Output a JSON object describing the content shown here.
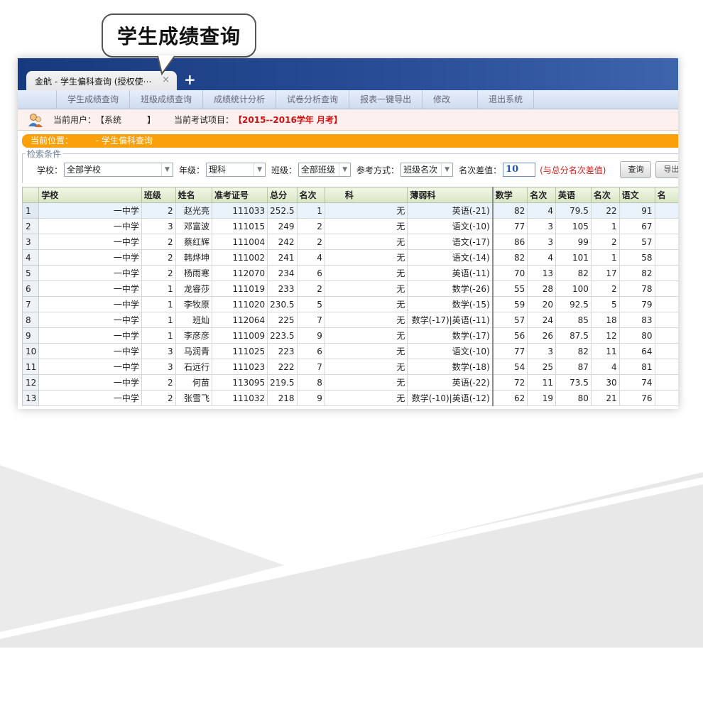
{
  "callout": {
    "text": "学生成绩查询"
  },
  "tab": {
    "title": "金航 - 学生偏科查询 (授权使⋯",
    "close": "×",
    "new": "+"
  },
  "menu": [
    "学生成绩查询",
    "班级成绩查询",
    "成绩统计分析",
    "试卷分析查询",
    "报表一键导出",
    "修改",
    "退出系统"
  ],
  "user": {
    "label": "当前用户：",
    "value": "【系统　　　】",
    "exam_label": "当前考试项目：",
    "exam_value": "【2015--2016学年 月考】"
  },
  "location": {
    "label": "当前位置：",
    "value": "- 学生偏科查询"
  },
  "search": {
    "legend": "检索条件",
    "school_label": "学校：",
    "school_value": "全部学校",
    "grade_label": "年级：",
    "grade_value": "理科",
    "class_label": "班级：",
    "class_value": "全部班级",
    "mode_label": "参考方式：",
    "mode_value": "班级名次",
    "diff_label": "名次差值：",
    "diff_value": "10",
    "diff_note": "(与总分名次差值)",
    "query_button": "查询",
    "export_button": "导出"
  },
  "table": {
    "headers": [
      "",
      "学校",
      "班级",
      "姓名",
      "准考证号",
      "总分",
      "名次",
      "科",
      "薄弱科",
      "数学",
      "名次",
      "英语",
      "名次",
      "语文",
      "名"
    ],
    "rows": [
      [
        "1",
        "一中学",
        "2",
        "赵光亮",
        "111033",
        "252.5",
        "1",
        "无",
        "英语(-21)",
        "82",
        "4",
        "79.5",
        "22",
        "91"
      ],
      [
        "2",
        "一中学",
        "3",
        "邓富波",
        "111015",
        "249",
        "2",
        "无",
        "语文(-10)",
        "77",
        "3",
        "105",
        "1",
        "67"
      ],
      [
        "3",
        "一中学",
        "2",
        "蔡红辉",
        "111004",
        "242",
        "2",
        "无",
        "语文(-17)",
        "86",
        "3",
        "99",
        "2",
        "57"
      ],
      [
        "4",
        "一中学",
        "2",
        "韩烨坤",
        "111002",
        "241",
        "4",
        "无",
        "语文(-14)",
        "82",
        "4",
        "101",
        "1",
        "58"
      ],
      [
        "5",
        "一中学",
        "2",
        "杨雨寒",
        "112070",
        "234",
        "6",
        "无",
        "英语(-11)",
        "70",
        "13",
        "82",
        "17",
        "82"
      ],
      [
        "6",
        "一中学",
        "1",
        "龙睿莎",
        "111019",
        "233",
        "2",
        "无",
        "数学(-26)",
        "55",
        "28",
        "100",
        "2",
        "78"
      ],
      [
        "7",
        "一中学",
        "1",
        "李牧原",
        "111020",
        "230.5",
        "5",
        "无",
        "数学(-15)",
        "59",
        "20",
        "92.5",
        "5",
        "79"
      ],
      [
        "8",
        "一中学",
        "1",
        "班灿",
        "112064",
        "225",
        "7",
        "无",
        "数学(-17)|英语(-11)",
        "57",
        "24",
        "85",
        "18",
        "83"
      ],
      [
        "9",
        "一中学",
        "1",
        "李彦彦",
        "111009",
        "223.5",
        "9",
        "无",
        "数学(-17)",
        "56",
        "26",
        "87.5",
        "12",
        "80"
      ],
      [
        "10",
        "一中学",
        "3",
        "马润青",
        "111025",
        "223",
        "6",
        "无",
        "语文(-10)",
        "77",
        "3",
        "82",
        "11",
        "64"
      ],
      [
        "11",
        "一中学",
        "3",
        "石远行",
        "111023",
        "222",
        "7",
        "无",
        "数学(-18)",
        "54",
        "25",
        "87",
        "4",
        "81"
      ],
      [
        "12",
        "一中学",
        "2",
        "何苗",
        "113095",
        "219.5",
        "8",
        "无",
        "英语(-22)",
        "72",
        "11",
        "73.5",
        "30",
        "74"
      ],
      [
        "13",
        "一中学",
        "2",
        "张雪飞",
        "111032",
        "218",
        "9",
        "无",
        "数学(-10)|英语(-12)",
        "62",
        "19",
        "80",
        "21",
        "76"
      ]
    ]
  },
  "colors": {
    "titlebar": "#1f4388",
    "accent": "#f9a00a",
    "exam": "#d01010"
  }
}
